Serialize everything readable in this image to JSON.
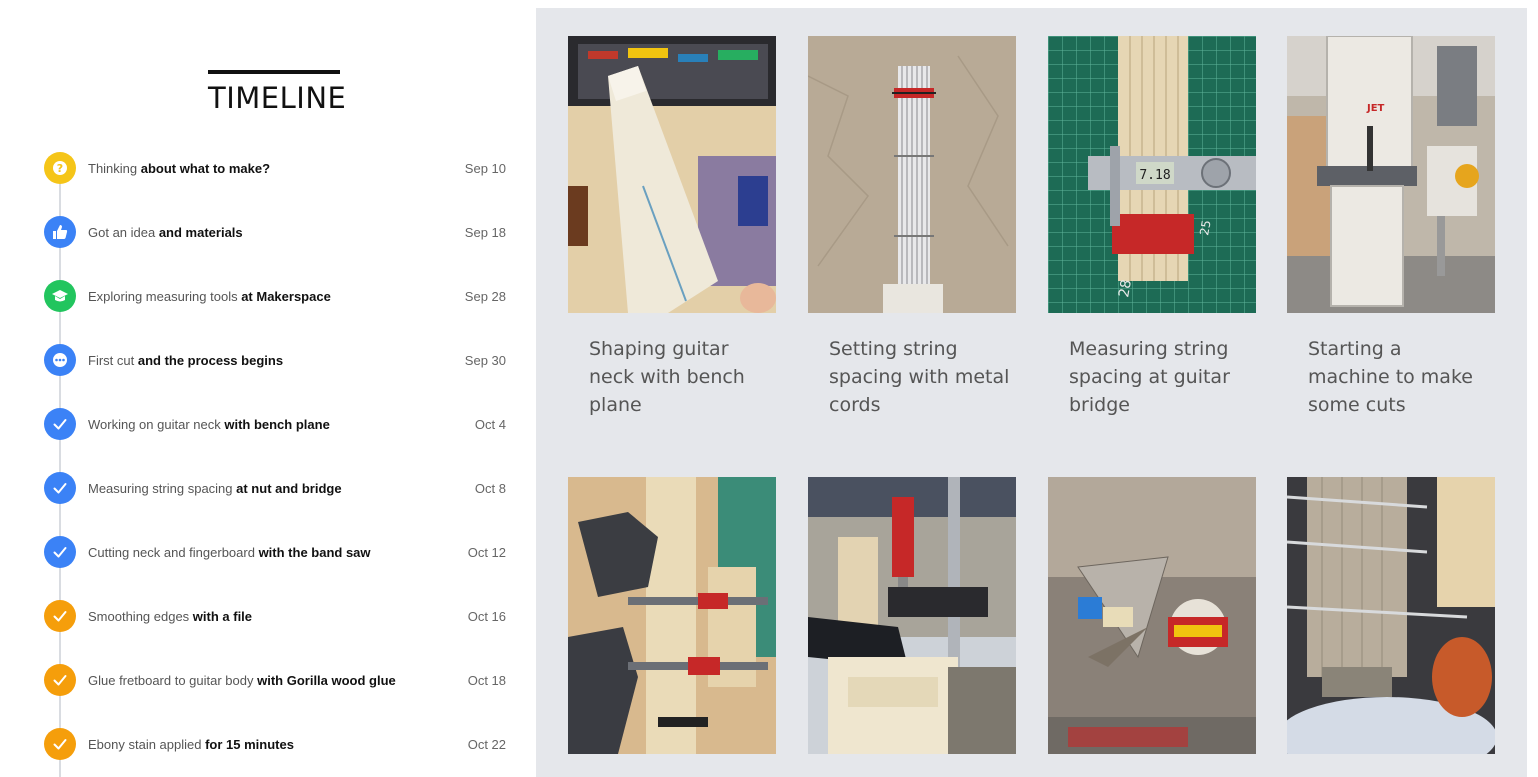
{
  "timeline": {
    "title": "TIMELINE",
    "items": [
      {
        "text": "Thinking ",
        "bold": "about what to make?",
        "date": "Sep 10",
        "color": "#f5c518",
        "icon": "question-icon"
      },
      {
        "text": "Got an idea ",
        "bold": "and materials",
        "date": "Sep 18",
        "color": "#3b82f6",
        "icon": "thumbs-up-icon"
      },
      {
        "text": "Exploring measuring tools ",
        "bold": "at Makerspace",
        "date": "Sep 28",
        "color": "#22c55e",
        "icon": "graduation-cap-icon"
      },
      {
        "text": "First cut ",
        "bold": "and the process begins",
        "date": "Sep 30",
        "color": "#3b82f6",
        "icon": "ellipsis-icon"
      },
      {
        "text": "Working on guitar neck ",
        "bold": "with bench plane",
        "date": "Oct 4",
        "color": "#3b82f6",
        "icon": "check-icon"
      },
      {
        "text": "Measuring string spacing ",
        "bold": "at nut and bridge",
        "date": "Oct 8",
        "color": "#3b82f6",
        "icon": "check-icon"
      },
      {
        "text": "Cutting neck and fingerboard ",
        "bold": "with the band saw",
        "date": "Oct 12",
        "color": "#3b82f6",
        "icon": "check-icon"
      },
      {
        "text": "Smoothing edges ",
        "bold": "with a file",
        "date": "Oct 16",
        "color": "#f59e0b",
        "icon": "check-icon"
      },
      {
        "text": "Glue fretboard to guitar body ",
        "bold": "with Gorilla wood glue",
        "date": "Oct 18",
        "color": "#f59e0b",
        "icon": "check-icon"
      },
      {
        "text": "Ebony stain applied ",
        "bold": "for 15 minutes",
        "date": "Oct 22",
        "color": "#f59e0b",
        "icon": "check-icon"
      }
    ]
  },
  "gallery": {
    "cards": [
      {
        "caption": "Shaping guitar neck with bench plane"
      },
      {
        "caption": "Setting string spacing with metal cords"
      },
      {
        "caption": "Measuring string spacing at guitar bridge"
      },
      {
        "caption": "Starting a machine to make some cuts"
      },
      {
        "caption": ""
      },
      {
        "caption": ""
      },
      {
        "caption": ""
      },
      {
        "caption": ""
      }
    ]
  },
  "photos": {
    "caliper_reading": "7.18"
  }
}
